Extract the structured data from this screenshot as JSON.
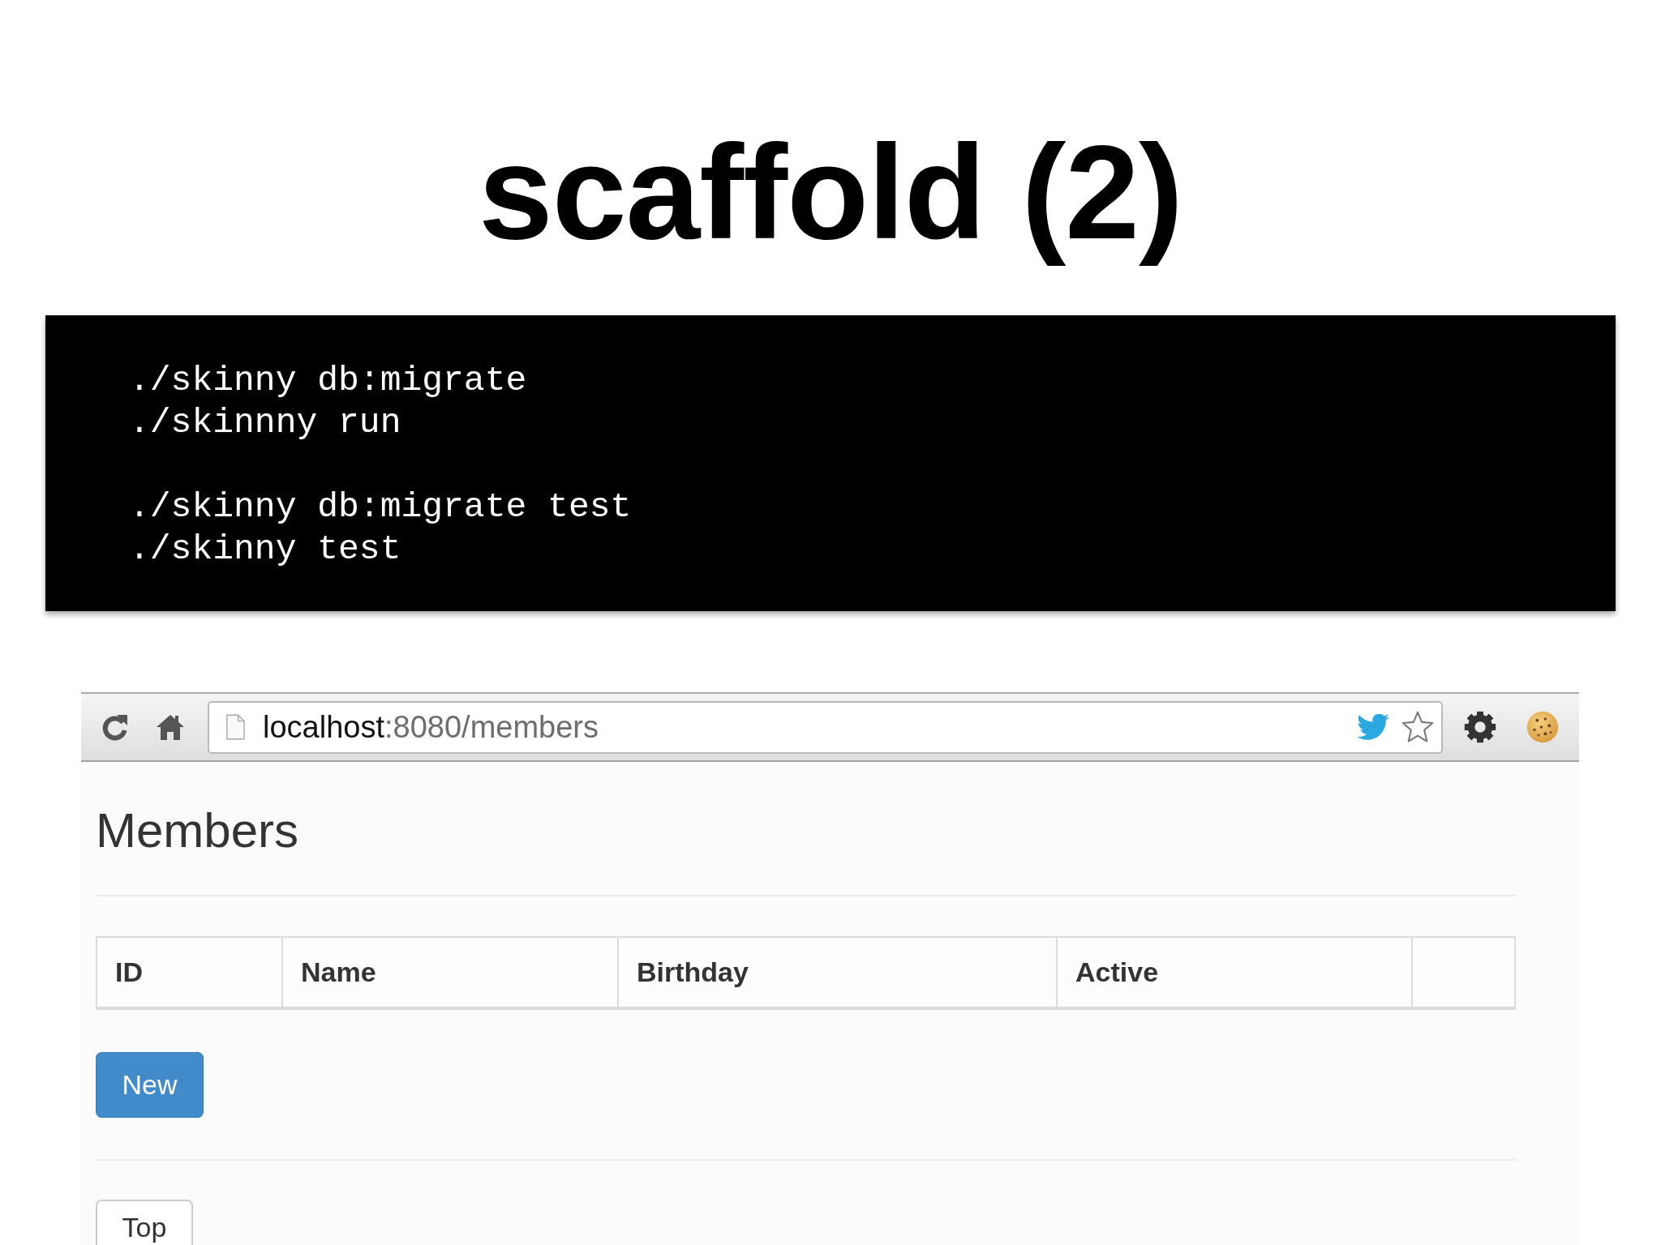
{
  "slide": {
    "title": "scaffold (2)"
  },
  "code_block": {
    "groups": [
      [
        "./skinny db:migrate",
        "./skinnny run"
      ],
      [
        "./skinny db:migrate test",
        "./skinny test"
      ]
    ]
  },
  "browser": {
    "address_bar": {
      "host": "localhost",
      "path": ":8080/members"
    },
    "page": {
      "heading": "Members",
      "table": {
        "columns": [
          "ID",
          "Name",
          "Birthday",
          "Active"
        ]
      },
      "new_button": {
        "label": "New"
      },
      "top_button": {
        "label": "Top"
      }
    }
  }
}
